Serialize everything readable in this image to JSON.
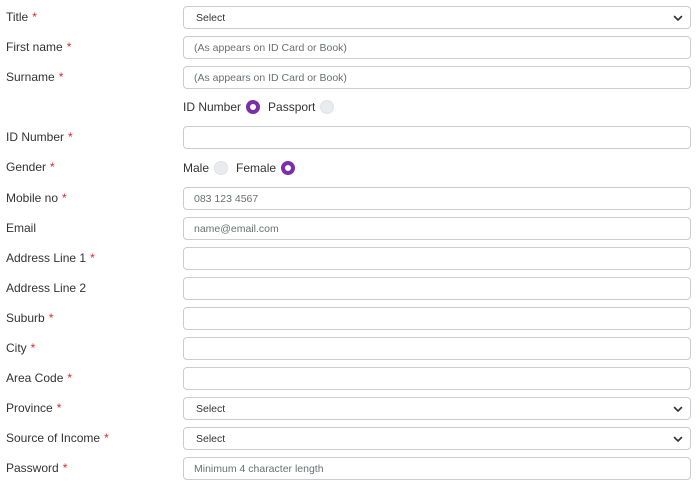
{
  "required_mark": "*",
  "accent_color": "#7b2ea8",
  "required_color": "#d9282f",
  "fields": {
    "title": {
      "label": "Title",
      "value": "Select"
    },
    "first_name": {
      "label": "First name",
      "placeholder": "(As appears on ID Card or Book)"
    },
    "surname": {
      "label": "Surname",
      "placeholder": "(As appears on ID Card or Book)"
    },
    "id_type": {
      "options": [
        {
          "label": "ID Number",
          "selected": true
        },
        {
          "label": "Passport",
          "selected": false
        }
      ]
    },
    "id_number": {
      "label": "ID Number",
      "placeholder": ""
    },
    "gender": {
      "label": "Gender",
      "options": [
        {
          "label": "Male",
          "selected": false
        },
        {
          "label": "Female",
          "selected": true
        }
      ]
    },
    "mobile": {
      "label": "Mobile no",
      "placeholder": "083 123 4567"
    },
    "email": {
      "label": "Email",
      "placeholder": "name@email.com"
    },
    "address1": {
      "label": "Address Line 1",
      "placeholder": ""
    },
    "address2": {
      "label": "Address Line 2",
      "placeholder": ""
    },
    "suburb": {
      "label": "Suburb",
      "placeholder": ""
    },
    "city": {
      "label": "City",
      "placeholder": ""
    },
    "area_code": {
      "label": "Area Code",
      "placeholder": ""
    },
    "province": {
      "label": "Province",
      "value": "Select"
    },
    "source_of_income": {
      "label": "Source of Income",
      "value": "Select"
    },
    "password": {
      "label": "Password",
      "placeholder": "Minimum 4 character length"
    }
  },
  "icons": {
    "select_arrow": "chevron-down-icon"
  }
}
